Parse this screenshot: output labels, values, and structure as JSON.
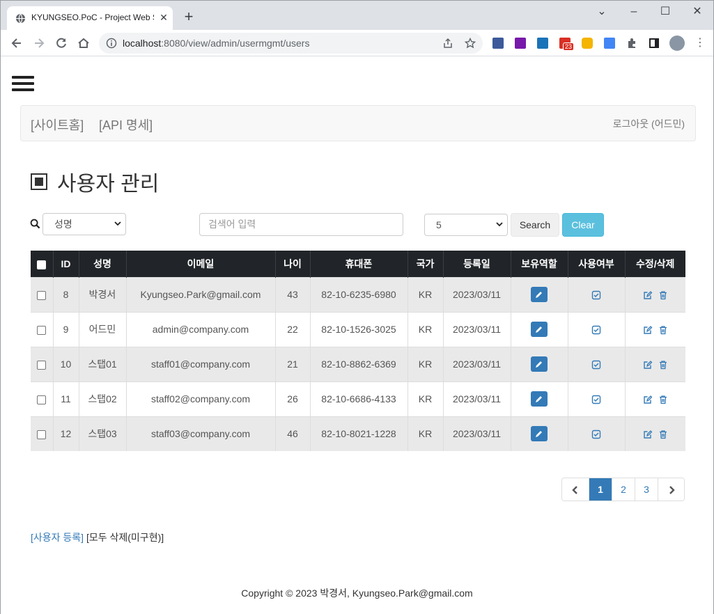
{
  "browser": {
    "tab_title": "KYUNGSEO.PoC - Project Web S",
    "url_host": "localhost",
    "url_path": ":8080/view/admin/usermgmt/users",
    "gmail_badge": "23"
  },
  "nav": {
    "site_home": "[사이트홈]",
    "api_spec": "[API 명세]",
    "logout": "로그아웃 (어드민)"
  },
  "page_title": "사용자 관리",
  "search": {
    "field_select": "성명",
    "placeholder": "검색어 입력",
    "page_size": "5",
    "search_label": "Search",
    "clear_label": "Clear"
  },
  "table": {
    "headers": [
      "ID",
      "성명",
      "이메일",
      "나이",
      "휴대폰",
      "국가",
      "등록일",
      "보유역할",
      "사용여부",
      "수정/삭제"
    ],
    "rows": [
      {
        "id": "8",
        "name": "박경서",
        "email": "Kyungseo.Park@gmail.com",
        "age": "43",
        "phone": "82-10-6235-6980",
        "country": "KR",
        "date": "2023/03/11"
      },
      {
        "id": "9",
        "name": "어드민",
        "email": "admin@company.com",
        "age": "22",
        "phone": "82-10-1526-3025",
        "country": "KR",
        "date": "2023/03/11"
      },
      {
        "id": "10",
        "name": "스탭01",
        "email": "staff01@company.com",
        "age": "21",
        "phone": "82-10-8862-6369",
        "country": "KR",
        "date": "2023/03/11"
      },
      {
        "id": "11",
        "name": "스탭02",
        "email": "staff02@company.com",
        "age": "26",
        "phone": "82-10-6686-4133",
        "country": "KR",
        "date": "2023/03/11"
      },
      {
        "id": "12",
        "name": "스탭03",
        "email": "staff03@company.com",
        "age": "46",
        "phone": "82-10-8021-1228",
        "country": "KR",
        "date": "2023/03/11"
      }
    ]
  },
  "pagination": {
    "pages": [
      "1",
      "2",
      "3"
    ],
    "active": "1"
  },
  "bottom": {
    "register": "[사용자 등록]",
    "delete_all": "[모두 삭제(미구현)]"
  },
  "footer": "Copyright © 2023 박경서, Kyungseo.Park@gmail.com",
  "colors": {
    "primary": "#337ab7",
    "info": "#5bc0de",
    "table_header": "#212529"
  }
}
